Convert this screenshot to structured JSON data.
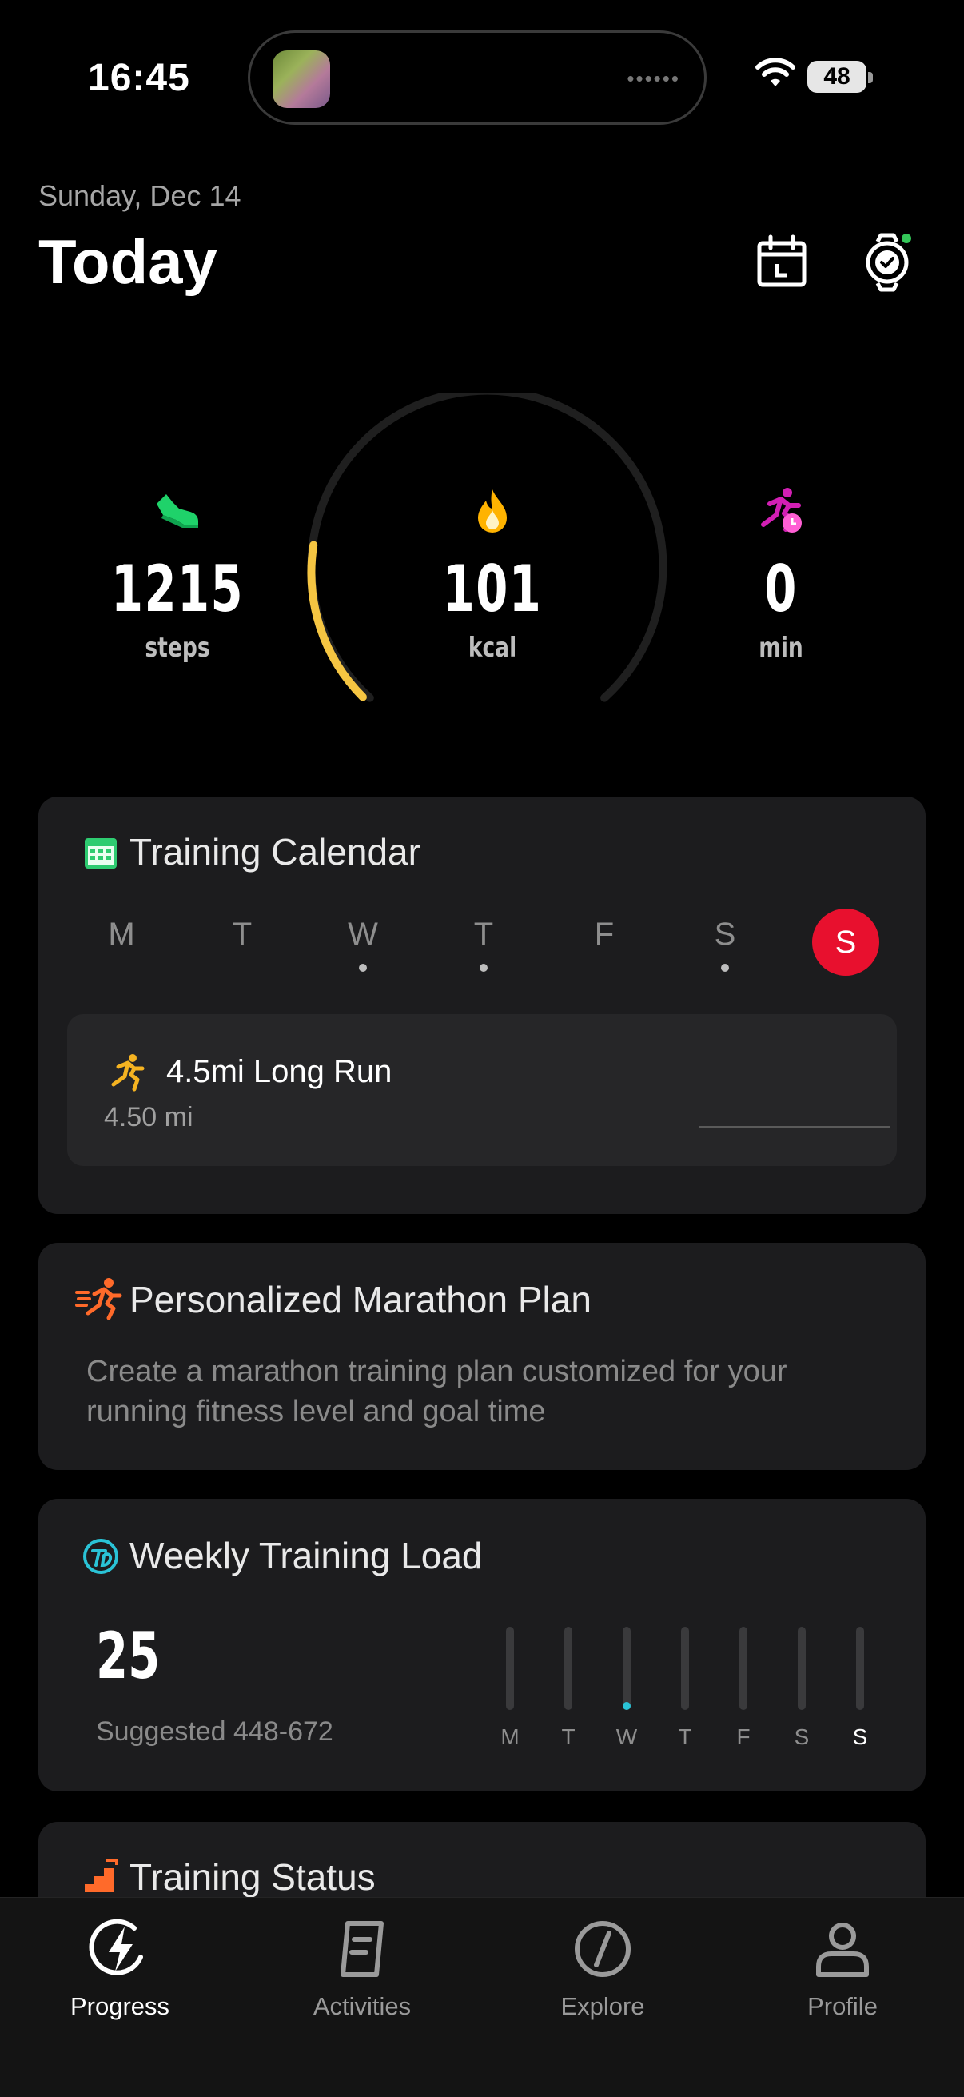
{
  "status_bar": {
    "time": "16:45",
    "battery": "48"
  },
  "header": {
    "date": "Sunday, Dec 14",
    "title": "Today"
  },
  "stats": {
    "steps": {
      "value": "1215",
      "unit": "steps"
    },
    "calories": {
      "value": "101",
      "unit": "kcal",
      "ring_progress": 0.2
    },
    "active": {
      "value": "0",
      "unit": "min"
    }
  },
  "training_calendar": {
    "title": "Training Calendar",
    "days": [
      "M",
      "T",
      "W",
      "T",
      "F",
      "S",
      "S"
    ],
    "days_with_activity": [
      2,
      3,
      5
    ],
    "selected_day": 6,
    "workout": {
      "name": "4.5mi Long Run",
      "distance": "4.50 mi"
    }
  },
  "marathon_plan": {
    "title": "Personalized Marathon Plan",
    "description": "Create a marathon training plan customized for your running fitness level and goal time"
  },
  "weekly_load": {
    "title": "Weekly Training Load",
    "value": "25",
    "suggested": "Suggested 448-672",
    "days": [
      "M",
      "T",
      "W",
      "T",
      "F",
      "S",
      "S"
    ],
    "day_levels": [
      0,
      0,
      0.06,
      0,
      0,
      0,
      0
    ],
    "today_index": 6
  },
  "training_status": {
    "title": "Training Status"
  },
  "tabs": [
    {
      "label": "Progress",
      "icon": "bolt-icon",
      "active": true
    },
    {
      "label": "Activities",
      "icon": "document-icon",
      "active": false
    },
    {
      "label": "Explore",
      "icon": "compass-icon",
      "active": false
    },
    {
      "label": "Profile",
      "icon": "person-icon",
      "active": false
    }
  ],
  "colors": {
    "ring_track": "#1f1f1f",
    "ring_fill": "#f5c542",
    "accent_red": "#e8102e",
    "load_accent": "#2ac3d6",
    "steps_green": "#1fd26a",
    "flame_orange": "#ffb300",
    "active_magenta": "#d21fb4"
  }
}
